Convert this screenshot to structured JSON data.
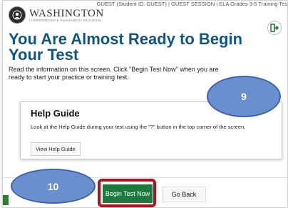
{
  "header": {
    "guest_info": "GUEST (Student ID: GUEST) | GUEST SESSION | ELA Grades 3-5 Training Tes",
    "logo_name": "WASHINGTON",
    "logo_sub": "COMPREHENSIVE ASSESSMENT PROGRAM"
  },
  "main": {
    "title": "You Are Almost Ready to Begin Your Test",
    "intro": "Read the information on this screen. Click \"Begin Test Now\" when you are ready to start your practice or training test."
  },
  "help_guide": {
    "heading": "Help Guide",
    "description": "Look at the Help Guide during your test using the \"?\" button in the top corner of the screen.",
    "button_label": "View Help Guide"
  },
  "actions": {
    "begin_label": "Begin Test Now",
    "back_label": "Go Back"
  },
  "annotations": {
    "marker_9": "9",
    "marker_10": "10"
  },
  "colors": {
    "title": "#13557f",
    "begin_button": "#1b7a3c",
    "highlight": "#a3181f",
    "marker": "#6a8ed0"
  },
  "icons": [
    "seal-logo-icon",
    "exit-icon"
  ]
}
